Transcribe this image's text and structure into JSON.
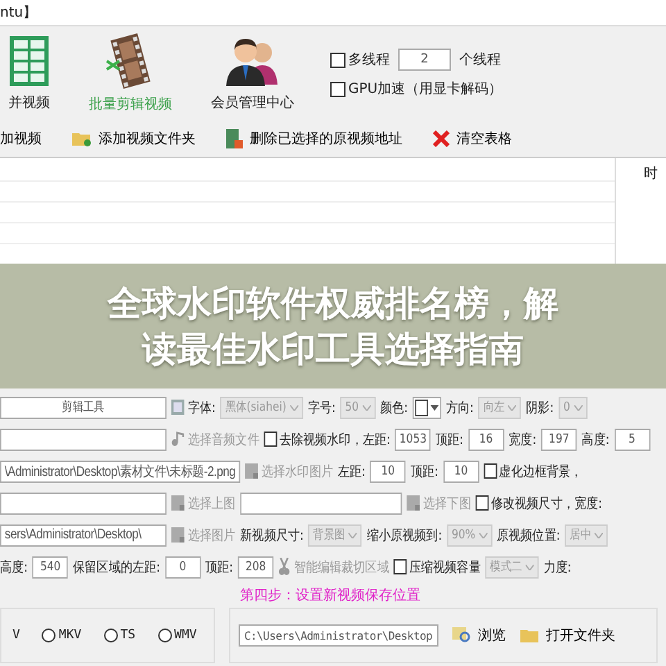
{
  "window": {
    "title": "ntu】"
  },
  "toolbar": {
    "tools": [
      {
        "label": "并视频",
        "selected": false
      },
      {
        "label": "批量剪辑视频",
        "selected": true
      },
      {
        "label": "会员管理中心",
        "selected": false
      }
    ],
    "multithread": {
      "label": "多线程",
      "checked": false,
      "value": "2",
      "unit": "个线程"
    },
    "gpu": {
      "label": "GPU加速（用显卡解码）",
      "checked": false
    }
  },
  "actions": [
    "加视频",
    "添加视频文件夹",
    "删除已选择的原视频地址",
    "清空表格"
  ],
  "table": {
    "columns": [
      "时"
    ]
  },
  "headline": [
    "全球水印软件权威排名榜，解",
    "读最佳水印工具选择指南"
  ],
  "settings": [
    [
      {
        "kind": "field",
        "value": "剪辑工具"
      },
      {
        "kind": "fonttool",
        "label": "字体:",
        "disabled": false
      },
      {
        "kind": "select",
        "value": "黑体(siahei)",
        "disabled": true
      },
      {
        "kind": "text",
        "text": "字号:"
      },
      {
        "kind": "select",
        "value": "50",
        "disabled": true
      },
      {
        "kind": "text",
        "text": "颜色:"
      },
      {
        "kind": "colorpick"
      },
      {
        "kind": "text",
        "text": "方向:"
      },
      {
        "kind": "select",
        "value": "向左",
        "disabled": true
      },
      {
        "kind": "text",
        "text": "阴影:"
      },
      {
        "kind": "select",
        "value": "0",
        "disabled": true
      }
    ],
    [
      {
        "kind": "field"
      },
      {
        "kind": "audiotool",
        "label": "选择音频文件",
        "disabled": true
      },
      {
        "kind": "checkbox",
        "label": "去除视频水印，左距:",
        "checked": false
      },
      {
        "kind": "number",
        "value": "1053"
      },
      {
        "kind": "text",
        "text": "顶距:"
      },
      {
        "kind": "number",
        "value": "16"
      },
      {
        "kind": "text",
        "text": "宽度:"
      },
      {
        "kind": "number",
        "value": "197"
      },
      {
        "kind": "text",
        "text": "高度:"
      },
      {
        "kind": "number",
        "value": "5"
      }
    ],
    [
      {
        "kind": "path",
        "value": "\\Administrator\\Desktop\\素材文件\\未标题-2.png"
      },
      {
        "kind": "imagetool",
        "label": "选择水印图片",
        "disabled": true
      },
      {
        "kind": "text",
        "text": "左距:"
      },
      {
        "kind": "number",
        "value": "10"
      },
      {
        "kind": "text",
        "text": "顶距:"
      },
      {
        "kind": "number",
        "value": "10"
      },
      {
        "kind": "checkbox",
        "label": "虚化边框背景，",
        "checked": false
      }
    ],
    [
      {
        "kind": "field"
      },
      {
        "kind": "imagetool",
        "label": "选择上图",
        "disabled": true
      },
      {
        "kind": "widefield"
      },
      {
        "kind": "imagetool",
        "label": "选择下图",
        "disabled": true
      },
      {
        "kind": "checkbox",
        "label": "修改视频尺寸，宽度:",
        "checked": false
      }
    ],
    [
      {
        "kind": "path",
        "value": "sers\\Administrator\\Desktop\\"
      },
      {
        "kind": "imagetool",
        "label": "选择图片",
        "disabled": true
      },
      {
        "kind": "text",
        "text": "新视频尺寸:"
      },
      {
        "kind": "select",
        "value": "背景图",
        "disabled": true
      },
      {
        "kind": "text",
        "text": "缩小原视频到:"
      },
      {
        "kind": "select",
        "value": "90%",
        "disabled": true
      },
      {
        "kind": "text",
        "text": "原视频位置:"
      },
      {
        "kind": "select",
        "value": "居中",
        "disabled": true
      }
    ],
    [
      {
        "kind": "text",
        "text": "高度:"
      },
      {
        "kind": "number",
        "value": "540"
      },
      {
        "kind": "text",
        "text": "保留区域的左距:"
      },
      {
        "kind": "number",
        "value": "0"
      },
      {
        "kind": "text",
        "text": "顶距:"
      },
      {
        "kind": "number",
        "value": "208"
      },
      {
        "kind": "cuttool",
        "label": "智能编辑裁切区域",
        "disabled": true
      },
      {
        "kind": "checkbox",
        "label": "压缩视频容量",
        "checked": false
      },
      {
        "kind": "select",
        "value": "模式二",
        "disabled": true
      },
      {
        "kind": "text",
        "text": "力度:"
      }
    ]
  ],
  "formats": [
    {
      "kind": "text",
      "label": "V"
    },
    {
      "kind": "radio",
      "label": "MKV",
      "selected": false
    },
    {
      "kind": "radio",
      "label": "TS",
      "selected": false
    },
    {
      "kind": "radio",
      "label": "WMV",
      "selected": false
    }
  ],
  "save": {
    "step": "第四步：设置新视频保存位置",
    "path": "C:\\Users\\Administrator\\Desktop",
    "buttons": [
      "浏览",
      "打开文件夹"
    ]
  }
}
